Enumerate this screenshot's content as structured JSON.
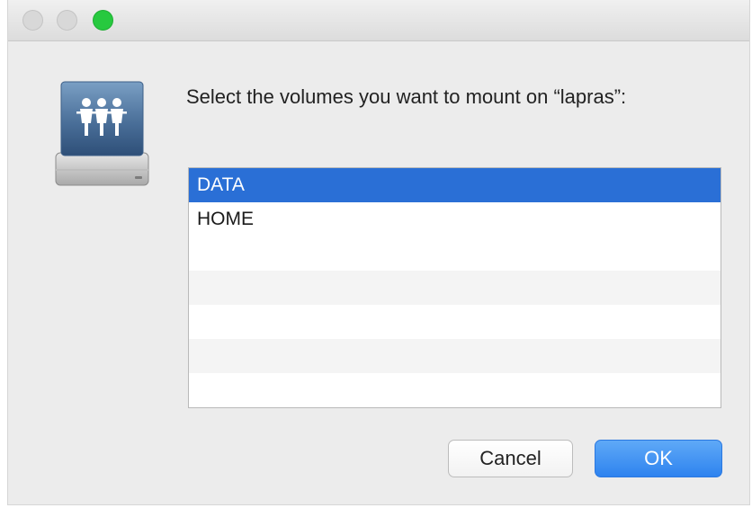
{
  "window": {
    "controls": [
      "close",
      "minimize",
      "zoom"
    ],
    "zoom_color": "#27c93f"
  },
  "dialog": {
    "icon": "shared-server-icon",
    "prompt": "Select the volumes you want to mount on “lapras”:",
    "volumes": [
      {
        "label": "DATA",
        "selected": true
      },
      {
        "label": "HOME",
        "selected": false
      }
    ],
    "selection_color": "#2a6fd6"
  },
  "buttons": {
    "cancel_label": "Cancel",
    "ok_label": "OK",
    "ok_color": "#3a8cf0"
  }
}
